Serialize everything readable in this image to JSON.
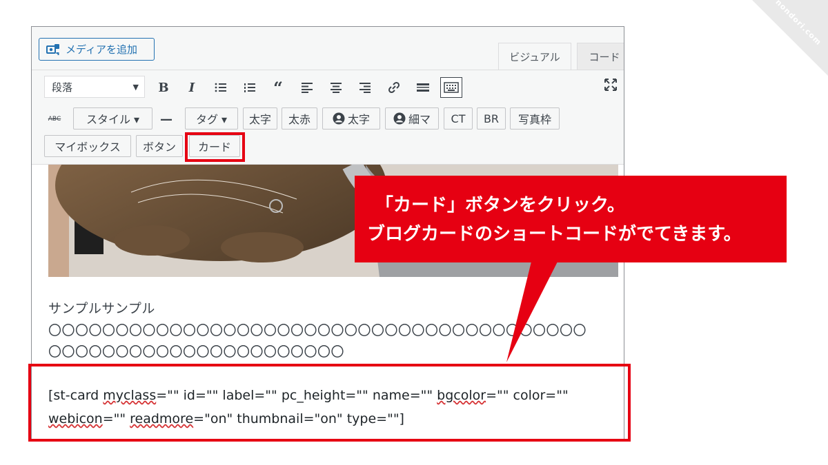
{
  "watermark": "nondori.com",
  "editor": {
    "media_button": "メディアを追加",
    "tabs": [
      {
        "label": "ビジュアル",
        "active": true
      },
      {
        "label": "コード",
        "active": false
      }
    ],
    "format_select": "段落",
    "toolbar_icons": [
      "bold",
      "italic",
      "bulleted-list",
      "numbered-list",
      "blockquote",
      "align-left",
      "align-center",
      "align-right",
      "link",
      "read-more",
      "toolbar-toggle",
      "fullscreen"
    ],
    "row2": {
      "style_select": "スタイル ▾",
      "tag_select": "タグ ▾",
      "buttons": [
        "太字",
        "太赤",
        "太字",
        "細マ",
        "CT",
        "BR",
        "写真枠"
      ]
    },
    "row3": {
      "buttons": [
        "マイボックス",
        "ボタン",
        "カード"
      ]
    }
  },
  "content": {
    "sample_text": "サンプルサンプル",
    "circles_line1": "〇〇〇〇〇〇〇〇〇〇〇〇〇〇〇〇〇〇〇〇〇〇〇〇〇〇〇〇〇〇〇〇〇〇〇〇〇〇〇〇",
    "circles_line2": "〇〇〇〇〇〇〇〇〇〇〇〇〇〇〇〇〇〇〇〇〇〇",
    "shortcode_line1_parts": [
      "[st-card ",
      "myclass",
      "=\"\" id=\"\" label=\"\" pc_height=\"\" name=\"\" ",
      "bgcolor",
      "=\"\" color=\"\""
    ],
    "shortcode_line2_parts": [
      "webicon",
      "=\"\" ",
      "readmore",
      "=\"on\" thumbnail=\"on\" type=\"\"]"
    ]
  },
  "callout": {
    "line1": "「カード」ボタンをクリック。",
    "line2": "ブログカードのショートコードがでてきます。"
  },
  "colors": {
    "accent_red": "#e60012",
    "wp_blue": "#2271b1",
    "toolbar_bg": "#f6f7f7"
  }
}
